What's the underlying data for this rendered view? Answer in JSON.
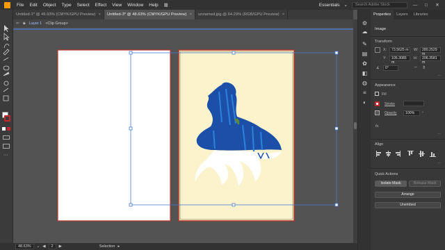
{
  "menubar": {
    "items": [
      "File",
      "Edit",
      "Object",
      "Type",
      "Select",
      "Effect",
      "View",
      "Window",
      "Help"
    ],
    "workspace": "Essentials",
    "search_placeholder": "Search Adobe Stock",
    "window_buttons": [
      "—",
      "□",
      "✕"
    ]
  },
  "tabs": [
    {
      "label": "Untitled-1* @ 46.93% (CMYK/GPU Preview)",
      "active": false
    },
    {
      "label": "Untitled-3* @ 48.63% (CMYK/GPU Preview)",
      "active": true
    },
    {
      "label": "unnamed.jpg @ 64.29% (RGB/GPU Preview)",
      "active": false
    }
  ],
  "tab_close": "×",
  "breadcrumb": {
    "layer": "Layer 1",
    "group": "<Clip Group>"
  },
  "panel": {
    "tabs": [
      "Properties",
      "Layers",
      "Libraries"
    ],
    "selection_type": "Image",
    "transform": {
      "title": "Transform",
      "x_label": "X:",
      "x_value": "73.5625 m",
      "y_label": "Y:",
      "y_value": "105.3085 m",
      "w_label": "W:",
      "w_value": "280.2529 m",
      "h_label": "H:",
      "h_value": "206.3581 m",
      "rotate_value": "0°"
    },
    "appearance": {
      "title": "Appearance",
      "fill_label": "Fill",
      "stroke_label": "Stroke",
      "opacity_label": "Opacity",
      "opacity_value": "100%",
      "fx_label": "fx."
    },
    "align_title": "Align",
    "quick_actions": {
      "title": "Quick Actions",
      "isolate": "Isolate Mask",
      "release": "Release Mask",
      "arrange": "Arrange",
      "unembed": "Unembed"
    }
  },
  "status": {
    "zoom": "48.63%",
    "page": "2",
    "tool": "Selection"
  },
  "colors": {
    "accent": "#ff9a00",
    "artboard_cream": "#fbf3cc",
    "artboard_border": "#b8372c",
    "silhouette": "#1b4fa8",
    "selection": "#4a7bd6"
  }
}
